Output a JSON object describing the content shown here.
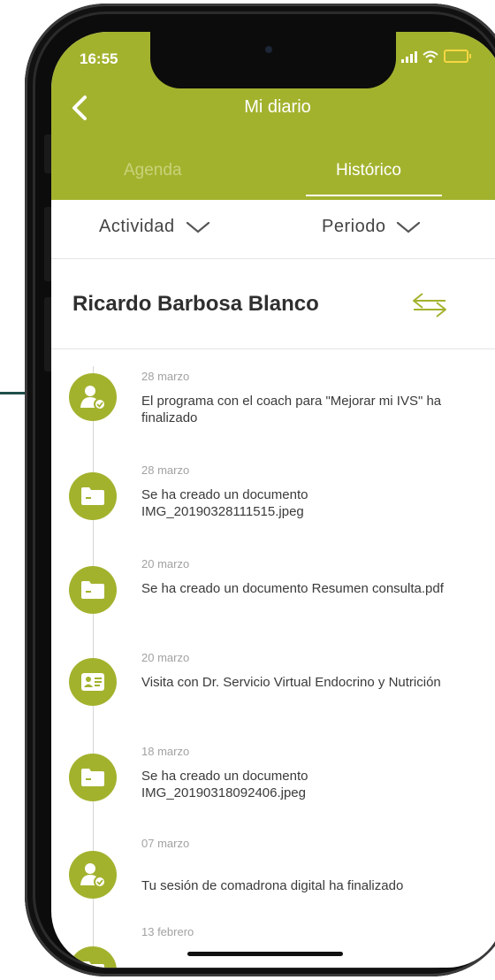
{
  "status_bar": {
    "time": "16:55"
  },
  "header": {
    "title": "Mi diario",
    "tabs": [
      {
        "label": "Agenda",
        "active": false
      },
      {
        "label": "Histórico",
        "active": true
      }
    ]
  },
  "filters": {
    "activity": "Actividad",
    "period": "Periodo"
  },
  "profile": {
    "name": "Ricardo Barbosa Blanco"
  },
  "timeline": [
    {
      "date": "28 marzo",
      "text": "El programa con el coach para \"Mejorar mi IVS\" ha finalizado",
      "icon": "coach-person-icon"
    },
    {
      "date": "28 marzo",
      "text": "Se ha creado un documento IMG_20190328111515.jpeg",
      "icon": "folder-icon"
    },
    {
      "date": "20 marzo",
      "text": "Se ha creado un documento Resumen consulta.pdf",
      "icon": "folder-icon"
    },
    {
      "date": "20 marzo",
      "text": "Visita con Dr. Servicio Virtual Endocrino y Nutrición",
      "icon": "id-card-icon"
    },
    {
      "date": "18 marzo",
      "text": "Se ha creado un documento IMG_20190318092406.jpeg",
      "icon": "folder-icon"
    },
    {
      "date": "07 marzo",
      "text": "Tu sesión de comadrona digital ha finalizado",
      "icon": "coach-person-icon"
    },
    {
      "date": "13 febrero",
      "text": "",
      "icon": "folder-icon"
    }
  ],
  "colors": {
    "accent": "#a3b22d",
    "inactive_tab": "#c9d27a",
    "annotation_line": "#1f4f4a"
  }
}
